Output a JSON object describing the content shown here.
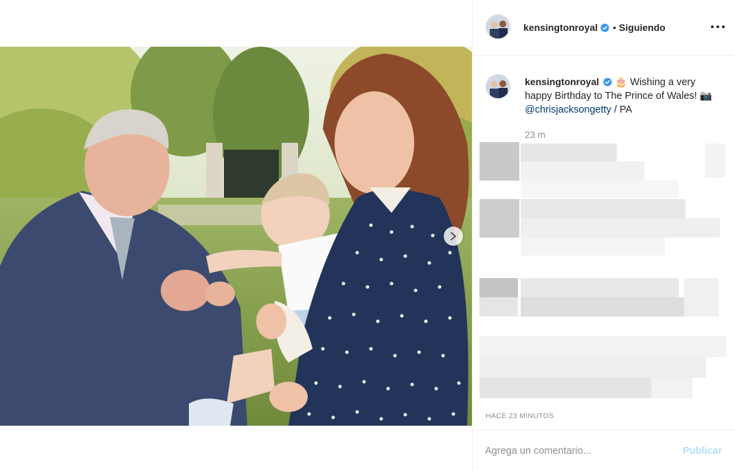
{
  "post": {
    "username": "kensingtonroyal",
    "follow_status": "Siguiendo",
    "separator": "•",
    "verified_icon": "verified-badge-icon",
    "more_icon": "more-options-icon"
  },
  "caption": {
    "username": "kensingtonroyal",
    "emoji_cake": "🎂",
    "text": "Wishing a very happy Birthday to The Prince of Wales!",
    "emoji_camera": "📷",
    "mention": "@chrisjacksongetty",
    "suffix": " / PA",
    "relative_time": "23 m"
  },
  "timestamp": "HACE 23 MINUTOS",
  "comment": {
    "placeholder": "Agrega un comentario...",
    "publish_label": "Publicar"
  },
  "colors": {
    "accent": "#0095f6",
    "publish_disabled": "#b2dffc",
    "verified": "#3897f0",
    "muted_text": "#8e8e8e"
  }
}
